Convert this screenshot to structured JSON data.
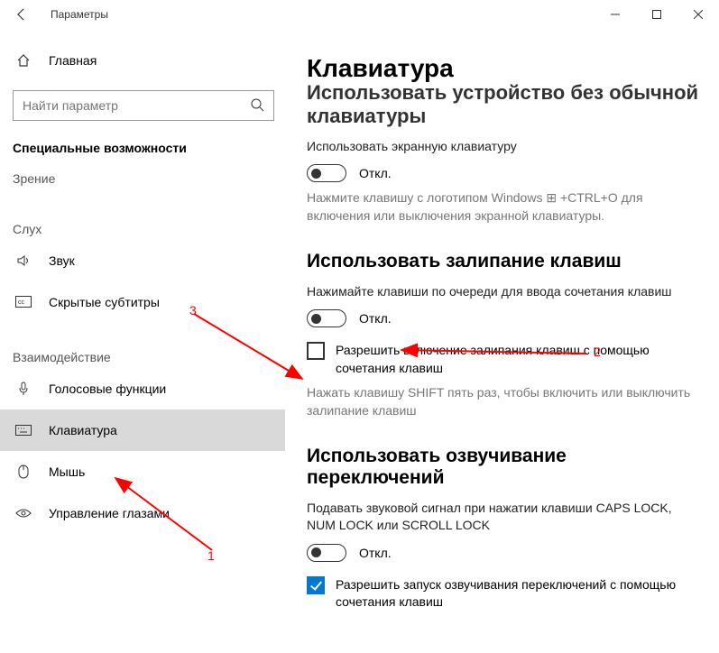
{
  "window": {
    "title": "Параметры"
  },
  "sidebar": {
    "home": "Главная",
    "search_placeholder": "Найти параметр",
    "category": "Специальные возможности",
    "groups": {
      "vision": "Зрение",
      "hearing": "Слух",
      "interaction": "Взаимодействие"
    },
    "items": {
      "sound": "Звук",
      "captions": "Скрытые субтитры",
      "speech": "Голосовые функции",
      "keyboard": "Клавиатура",
      "mouse": "Мышь",
      "eye": "Управление глазами"
    }
  },
  "page": {
    "title": "Клавиатура",
    "cut_heading": "Использовать устройство без обычной клавиатуры",
    "osk": {
      "use_label": "Использовать экранную клавиатуру",
      "state": "Откл.",
      "hint": "Нажмите клавишу с логотипом Windows ⊞ +CTRL+O для включения или выключения экранной клавиатуры."
    },
    "sticky": {
      "heading": "Использовать залипание клавиш",
      "desc": "Нажимайте клавиши по очереди для ввода сочетания клавиш",
      "state": "Откл.",
      "allow_label": "Разрешить включение залипания клавиш с помощью сочетания клавиш",
      "allow_hint": "Нажать клавишу SHIFT пять раз, чтобы включить или выключить залипание клавиш"
    },
    "toggle_keys": {
      "heading": "Использовать озвучивание переключений",
      "desc": "Подавать звуковой сигнал при нажатии клавиши CAPS LOCK, NUM LOCK или SCROLL LOCK",
      "state": "Откл.",
      "allow_label": "Разрешить запуск озвучивания переключений с помощью сочетания клавиш"
    }
  },
  "annotations": {
    "n1": "1",
    "n2": "2",
    "n3": "3"
  }
}
